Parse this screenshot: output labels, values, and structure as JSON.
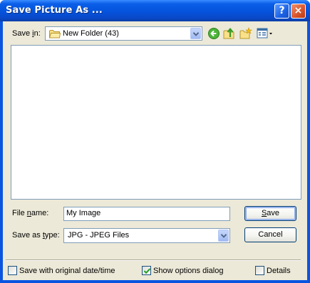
{
  "window": {
    "title": "Save Picture As ...",
    "help_label": "?",
    "close_label": "×"
  },
  "save_in": {
    "label_pre": "Save ",
    "label_accel": "i",
    "label_post": "n:",
    "value": "New Folder (43)"
  },
  "toolbar": {
    "icons": [
      "back-icon",
      "up-folder-icon",
      "new-folder-icon",
      "view-menu-icon"
    ]
  },
  "file_name": {
    "label_pre": "File ",
    "label_accel": "n",
    "label_post": "ame:",
    "value": "My Image"
  },
  "save_as_type": {
    "label_pre": "Save as ",
    "label_accel": "t",
    "label_post": "ype:",
    "value": "JPG - JPEG Files"
  },
  "buttons": {
    "save_accel": "S",
    "save_rest": "ave",
    "cancel": "Cancel"
  },
  "options": {
    "original_date": {
      "label": "Save with original date/time",
      "checked": false
    },
    "show_options": {
      "label": "Show options dialog",
      "checked": true
    },
    "details": {
      "label": "Details",
      "checked": false
    }
  },
  "colors": {
    "title_bar": "#0553dc",
    "dialog_bg": "#ece9d8",
    "control_border": "#7f9db9"
  }
}
